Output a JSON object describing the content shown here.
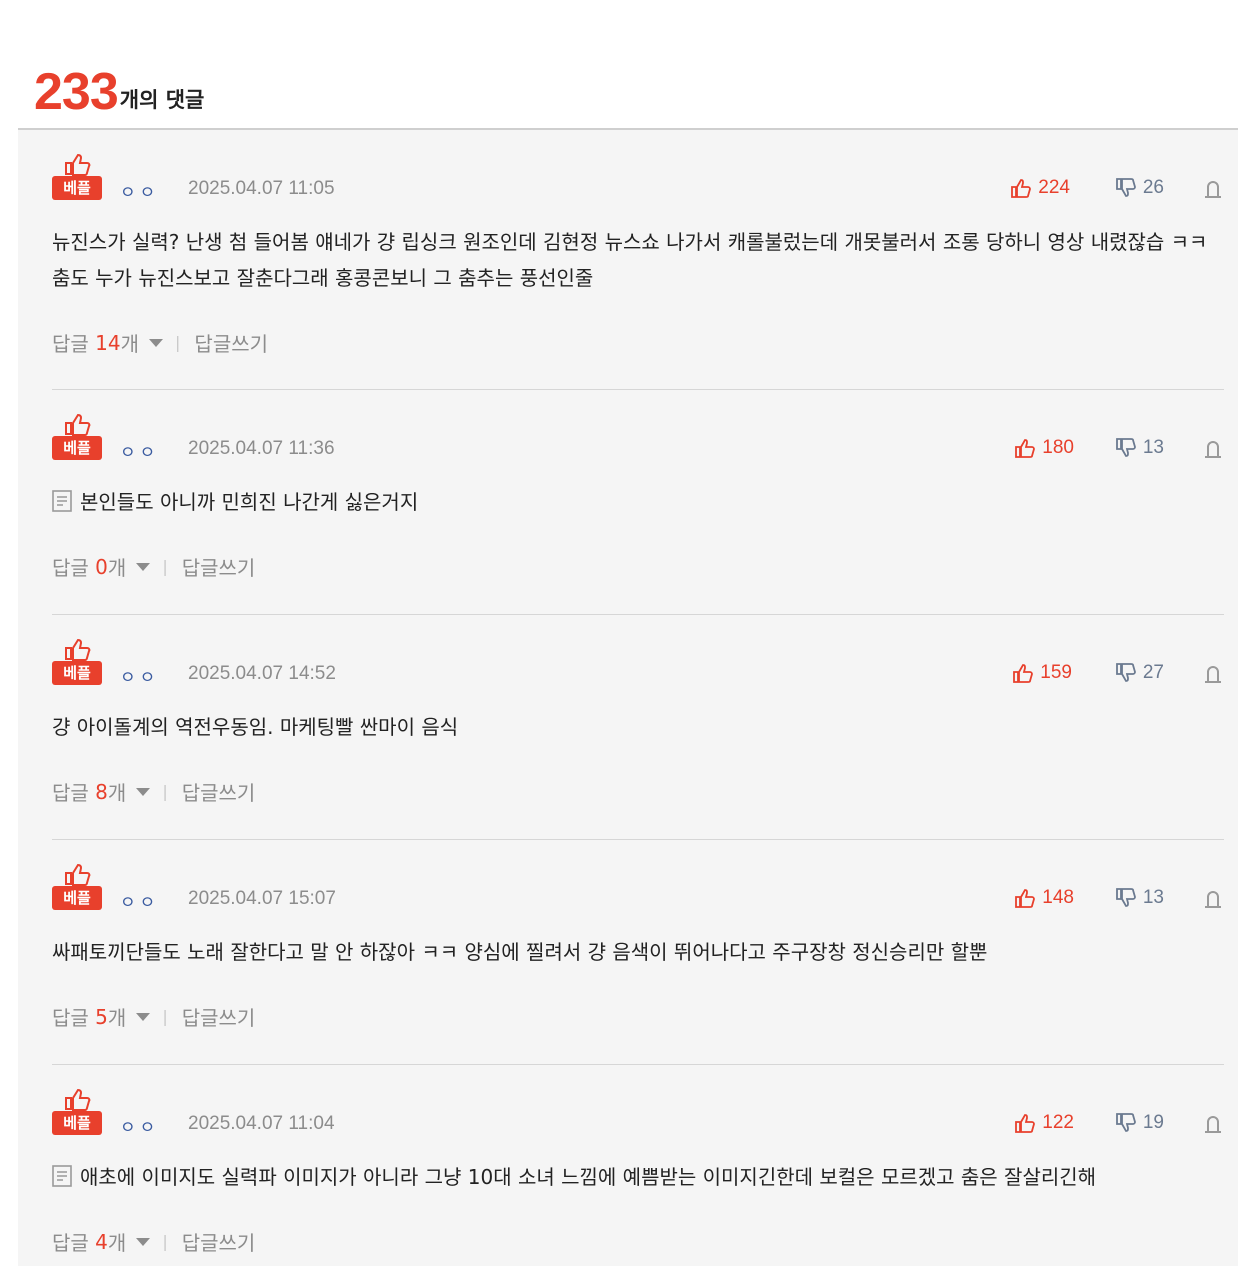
{
  "header": {
    "count": "233",
    "count_label": "개의 댓글"
  },
  "badge_label": "베플",
  "reply_label": "답글",
  "reply_unit": "개",
  "write_reply_label": "답글쓰기",
  "colors": {
    "accent": "#e8402c",
    "nick": "#3a5ba0",
    "muted": "#8c8c8c",
    "dislike": "#6b7a90",
    "list_bg": "#f5f5f5"
  },
  "icons": [
    "thumbs-up-icon",
    "thumbs-down-icon",
    "report-icon",
    "caret-down-icon",
    "note-icon"
  ],
  "comments": [
    {
      "nick": "ㅇㅇ",
      "date": "2025.04.07 11:05",
      "likes": "224",
      "dislikes": "26",
      "text": "뉴진스가 실력? 난생 첨 들어봄 얘네가 걍 립싱크 원조인데 김현정 뉴스쇼 나가서 캐롤불렀는데 개못불러서 조롱 당하니 영상 내렸잖습 ㅋㅋ 춤도 누가 뉴진스보고 잘춘다그래 홍콩콘보니 그 춤추는 풍선인줄",
      "replies": "14"
    },
    {
      "nick": "ㅇㅇ",
      "date": "2025.04.07 11:36",
      "likes": "180",
      "dislikes": "13",
      "text": "본인들도 아니까 민희진 나간게 싫은거지",
      "replies": "0"
    },
    {
      "nick": "ㅇㅇ",
      "date": "2025.04.07 14:52",
      "likes": "159",
      "dislikes": "27",
      "text": "걍 아이돌계의 역전우동임. 마케팅빨 싼마이 음식",
      "replies": "8"
    },
    {
      "nick": "ㅇㅇ",
      "date": "2025.04.07 15:07",
      "likes": "148",
      "dislikes": "13",
      "text": "싸패토끼단들도 노래 잘한다고 말 안 하잖아 ㅋㅋ 양심에 찔려서 걍 음색이 뛰어나다고 주구장창 정신승리만 할뿐",
      "replies": "5"
    },
    {
      "nick": "ㅇㅇ",
      "date": "2025.04.07 11:04",
      "likes": "122",
      "dislikes": "19",
      "text": "애초에 이미지도 실력파 이미지가 아니라 그냥 10대 소녀 느낌에 예쁨받는 이미지긴한데 보컬은 모르겠고 춤은 잘살리긴해",
      "replies": "4"
    }
  ]
}
